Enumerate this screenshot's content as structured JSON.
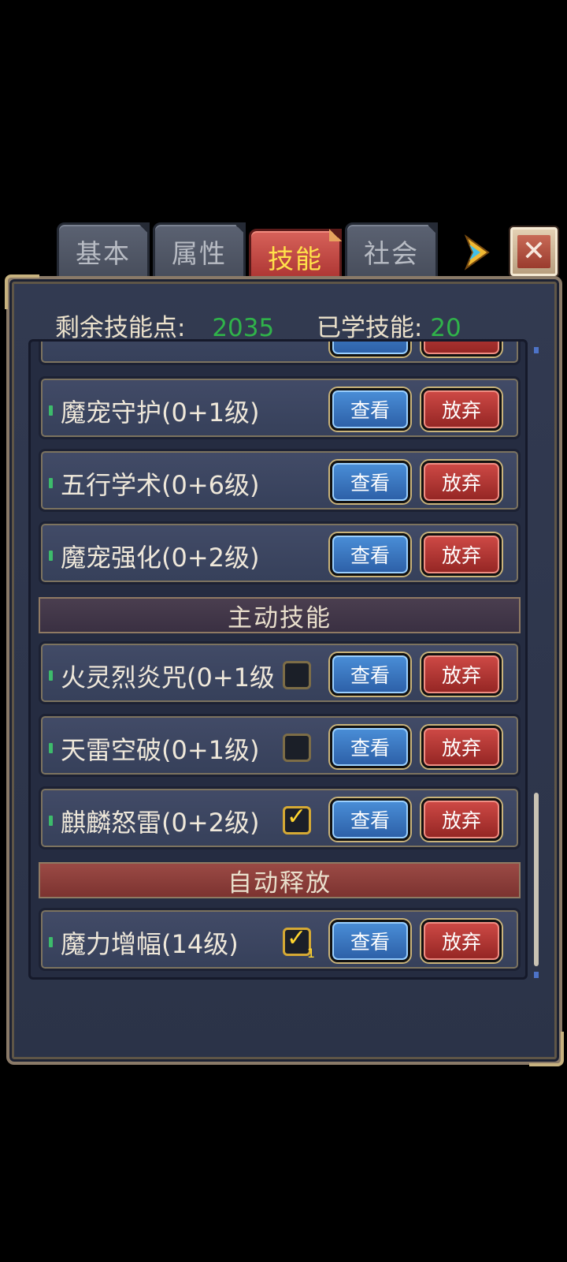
{
  "tabs": [
    {
      "label": "基本"
    },
    {
      "label": "属性"
    },
    {
      "label": "技能"
    },
    {
      "label": "社会"
    }
  ],
  "active_tab": "技能",
  "header": {
    "remaining_label": "剩余技能点:",
    "remaining_value": "2035",
    "learned_label": "已学技能:",
    "learned_value": "20"
  },
  "buttons": {
    "view": "查看",
    "drop": "放弃"
  },
  "skills_passive": [
    {
      "name": "魔宠守护(0+1级)"
    },
    {
      "name": "五行学术(0+6级)"
    },
    {
      "name": "魔宠强化(0+2级)"
    }
  ],
  "section_active": "主动技能",
  "skills_active": [
    {
      "name": "火灵烈炎咒(0+1级)",
      "checked": false
    },
    {
      "name": "天雷空破(0+1级)",
      "checked": false
    },
    {
      "name": "麒麟怒雷(0+2级)",
      "checked": true
    }
  ],
  "section_auto": "自动释放",
  "skills_auto": [
    {
      "name": "魔力增幅(14级)",
      "checked": true,
      "badge": "1"
    }
  ],
  "icons": {
    "check": "✓",
    "close": "✕"
  },
  "colors": {
    "value_green": "#30b34a",
    "active_tab_text": "#ffe14a"
  }
}
